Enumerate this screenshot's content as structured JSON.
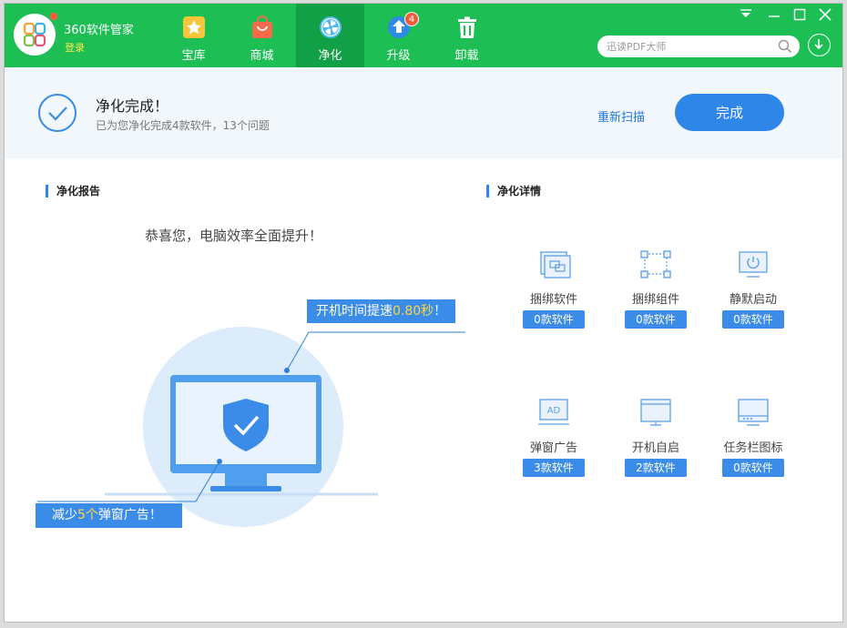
{
  "app": {
    "brand": "360软件管家",
    "login": "登录"
  },
  "nav": [
    {
      "label": "宝库",
      "icon": "star-icon"
    },
    {
      "label": "商城",
      "icon": "shopping-bag-icon"
    },
    {
      "label": "净化",
      "icon": "clean-fan-icon",
      "active": true
    },
    {
      "label": "升级",
      "icon": "upgrade-arrow-icon",
      "badge": "4"
    },
    {
      "label": "卸载",
      "icon": "trash-icon"
    }
  ],
  "search": {
    "placeholder": "迅读PDF大师"
  },
  "banner": {
    "title": "净化完成！",
    "subtitle": "已为您净化完成4款软件，13个问题",
    "rescan": "重新扫描",
    "finish": "完成"
  },
  "report": {
    "title": "净化报告",
    "congrats": "恭喜您，电脑效率全面提升！",
    "boot": {
      "prefix": "开机时间提速",
      "value": "0.80秒",
      "suffix": "！"
    },
    "popup": {
      "prefix": "减少",
      "value": "5个",
      "suffix": "弹窗广告！"
    }
  },
  "details": {
    "title": "净化详情",
    "items": [
      {
        "name": "捆绑软件",
        "count": "0款软件",
        "icon": "bundled-software-icon"
      },
      {
        "name": "捆绑组件",
        "count": "0款软件",
        "icon": "bundled-component-icon"
      },
      {
        "name": "静默启动",
        "count": "0款软件",
        "icon": "silent-start-icon"
      },
      {
        "name": "弹窗广告",
        "count": "3款软件",
        "icon": "popup-ad-icon"
      },
      {
        "name": "开机自启",
        "count": "2款软件",
        "icon": "autostart-icon"
      },
      {
        "name": "任务栏图标",
        "count": "0款软件",
        "icon": "taskbar-icon"
      }
    ]
  },
  "colors": {
    "topbar": "#1dbf55",
    "accent": "#2f86e9",
    "highlight": "#ffd840"
  }
}
